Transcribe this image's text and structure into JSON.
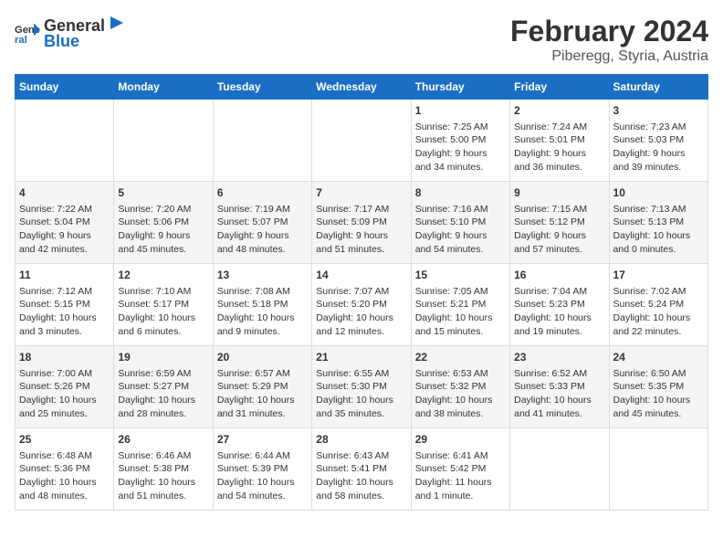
{
  "header": {
    "logo_line1": "General",
    "logo_line2": "Blue",
    "title": "February 2024",
    "subtitle": "Piberegg, Styria, Austria"
  },
  "columns": [
    "Sunday",
    "Monday",
    "Tuesday",
    "Wednesday",
    "Thursday",
    "Friday",
    "Saturday"
  ],
  "weeks": [
    [
      {
        "day": "",
        "info": ""
      },
      {
        "day": "",
        "info": ""
      },
      {
        "day": "",
        "info": ""
      },
      {
        "day": "",
        "info": ""
      },
      {
        "day": "1",
        "info": "Sunrise: 7:25 AM\nSunset: 5:00 PM\nDaylight: 9 hours\nand 34 minutes."
      },
      {
        "day": "2",
        "info": "Sunrise: 7:24 AM\nSunset: 5:01 PM\nDaylight: 9 hours\nand 36 minutes."
      },
      {
        "day": "3",
        "info": "Sunrise: 7:23 AM\nSunset: 5:03 PM\nDaylight: 9 hours\nand 39 minutes."
      }
    ],
    [
      {
        "day": "4",
        "info": "Sunrise: 7:22 AM\nSunset: 5:04 PM\nDaylight: 9 hours\nand 42 minutes."
      },
      {
        "day": "5",
        "info": "Sunrise: 7:20 AM\nSunset: 5:06 PM\nDaylight: 9 hours\nand 45 minutes."
      },
      {
        "day": "6",
        "info": "Sunrise: 7:19 AM\nSunset: 5:07 PM\nDaylight: 9 hours\nand 48 minutes."
      },
      {
        "day": "7",
        "info": "Sunrise: 7:17 AM\nSunset: 5:09 PM\nDaylight: 9 hours\nand 51 minutes."
      },
      {
        "day": "8",
        "info": "Sunrise: 7:16 AM\nSunset: 5:10 PM\nDaylight: 9 hours\nand 54 minutes."
      },
      {
        "day": "9",
        "info": "Sunrise: 7:15 AM\nSunset: 5:12 PM\nDaylight: 9 hours\nand 57 minutes."
      },
      {
        "day": "10",
        "info": "Sunrise: 7:13 AM\nSunset: 5:13 PM\nDaylight: 10 hours\nand 0 minutes."
      }
    ],
    [
      {
        "day": "11",
        "info": "Sunrise: 7:12 AM\nSunset: 5:15 PM\nDaylight: 10 hours\nand 3 minutes."
      },
      {
        "day": "12",
        "info": "Sunrise: 7:10 AM\nSunset: 5:17 PM\nDaylight: 10 hours\nand 6 minutes."
      },
      {
        "day": "13",
        "info": "Sunrise: 7:08 AM\nSunset: 5:18 PM\nDaylight: 10 hours\nand 9 minutes."
      },
      {
        "day": "14",
        "info": "Sunrise: 7:07 AM\nSunset: 5:20 PM\nDaylight: 10 hours\nand 12 minutes."
      },
      {
        "day": "15",
        "info": "Sunrise: 7:05 AM\nSunset: 5:21 PM\nDaylight: 10 hours\nand 15 minutes."
      },
      {
        "day": "16",
        "info": "Sunrise: 7:04 AM\nSunset: 5:23 PM\nDaylight: 10 hours\nand 19 minutes."
      },
      {
        "day": "17",
        "info": "Sunrise: 7:02 AM\nSunset: 5:24 PM\nDaylight: 10 hours\nand 22 minutes."
      }
    ],
    [
      {
        "day": "18",
        "info": "Sunrise: 7:00 AM\nSunset: 5:26 PM\nDaylight: 10 hours\nand 25 minutes."
      },
      {
        "day": "19",
        "info": "Sunrise: 6:59 AM\nSunset: 5:27 PM\nDaylight: 10 hours\nand 28 minutes."
      },
      {
        "day": "20",
        "info": "Sunrise: 6:57 AM\nSunset: 5:29 PM\nDaylight: 10 hours\nand 31 minutes."
      },
      {
        "day": "21",
        "info": "Sunrise: 6:55 AM\nSunset: 5:30 PM\nDaylight: 10 hours\nand 35 minutes."
      },
      {
        "day": "22",
        "info": "Sunrise: 6:53 AM\nSunset: 5:32 PM\nDaylight: 10 hours\nand 38 minutes."
      },
      {
        "day": "23",
        "info": "Sunrise: 6:52 AM\nSunset: 5:33 PM\nDaylight: 10 hours\nand 41 minutes."
      },
      {
        "day": "24",
        "info": "Sunrise: 6:50 AM\nSunset: 5:35 PM\nDaylight: 10 hours\nand 45 minutes."
      }
    ],
    [
      {
        "day": "25",
        "info": "Sunrise: 6:48 AM\nSunset: 5:36 PM\nDaylight: 10 hours\nand 48 minutes."
      },
      {
        "day": "26",
        "info": "Sunrise: 6:46 AM\nSunset: 5:38 PM\nDaylight: 10 hours\nand 51 minutes."
      },
      {
        "day": "27",
        "info": "Sunrise: 6:44 AM\nSunset: 5:39 PM\nDaylight: 10 hours\nand 54 minutes."
      },
      {
        "day": "28",
        "info": "Sunrise: 6:43 AM\nSunset: 5:41 PM\nDaylight: 10 hours\nand 58 minutes."
      },
      {
        "day": "29",
        "info": "Sunrise: 6:41 AM\nSunset: 5:42 PM\nDaylight: 11 hours\nand 1 minute."
      },
      {
        "day": "",
        "info": ""
      },
      {
        "day": "",
        "info": ""
      }
    ]
  ]
}
